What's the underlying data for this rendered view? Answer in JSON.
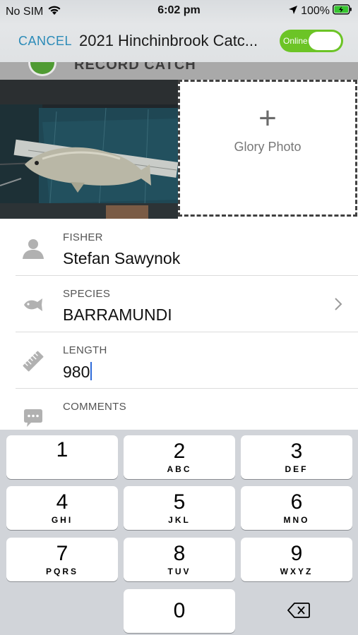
{
  "status_bar": {
    "carrier": "No SIM",
    "time": "6:02 pm",
    "battery": "100%",
    "icons": [
      "wifi-icon",
      "location-arrow-icon",
      "battery-charging-icon"
    ]
  },
  "nav": {
    "cancel_label": "CANCEL",
    "title": "2021 Hinchinbrook Catc...",
    "toggle_label": "Online",
    "toggle_on": true
  },
  "photo_strip": {
    "header_text": "RECORD CATCH",
    "glory_plus": "+",
    "glory_label": "Glory Photo"
  },
  "form": {
    "fisher": {
      "label": "FISHER",
      "value": "Stefan Sawynok",
      "icon": "person-icon"
    },
    "species": {
      "label": "SPECIES",
      "value": "BARRAMUNDI",
      "icon": "fish-icon"
    },
    "length": {
      "label": "LENGTH",
      "value": "980",
      "icon": "ruler-icon"
    },
    "comments": {
      "label": "COMMENTS",
      "value": "",
      "icon": "chat-bubble-icon"
    }
  },
  "keypad": {
    "keys": [
      {
        "digit": "1",
        "letters": ""
      },
      {
        "digit": "2",
        "letters": "ABC"
      },
      {
        "digit": "3",
        "letters": "DEF"
      },
      {
        "digit": "4",
        "letters": "GHI"
      },
      {
        "digit": "5",
        "letters": "JKL"
      },
      {
        "digit": "6",
        "letters": "MNO"
      },
      {
        "digit": "7",
        "letters": "PQRS"
      },
      {
        "digit": "8",
        "letters": "TUV"
      },
      {
        "digit": "9",
        "letters": "WXYZ"
      },
      {
        "digit": "0",
        "letters": ""
      }
    ]
  },
  "colors": {
    "accent": "#2b8bb8",
    "toggle": "#6cc426",
    "caret": "#2f6bd9",
    "keypad_bg": "#d1d4d9"
  }
}
